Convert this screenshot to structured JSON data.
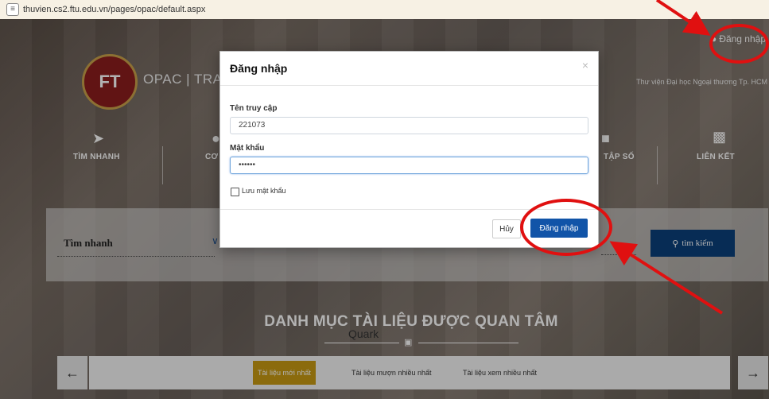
{
  "browser": {
    "url": "thuvien.cs2.ftu.edu.vn/pages/opac/default.aspx"
  },
  "header": {
    "login_link": "Đăng nhập",
    "opac_label": "OPAC | TRA",
    "library_name": "Thư viện Đại học Ngoại thương Tp. HCM",
    "logo_text": "FT"
  },
  "nav": [
    {
      "label": "TÌM NHANH",
      "icon": "rocket-icon"
    },
    {
      "label": "CƠ",
      "icon": "compass-icon"
    },
    {
      "label": "TẬP SỐ",
      "icon": "collection-icon"
    },
    {
      "label": "LIÊN KẾT",
      "icon": "sitemap-icon"
    }
  ],
  "search": {
    "mode_label": "Tìm nhanh",
    "button_label": "tìm kiếm"
  },
  "catalog": {
    "title": "DANH MỤC TÀI LIỆU ĐƯỢC QUAN TÂM",
    "background_text": "Quark",
    "tabs": [
      "Tài liệu mới nhất",
      "Tài liệu mượn nhiều nhất",
      "Tài liệu xem nhiều nhất"
    ],
    "prev_arrow": "←",
    "next_arrow": "→"
  },
  "modal": {
    "title": "Đăng nhập",
    "close": "×",
    "username_label": "Tên truy cập",
    "username_value": "221073",
    "password_label": "Mật khẩu",
    "password_value": "••••••",
    "remember_label": "Lưu mật khẩu",
    "cancel_label": "Hủy",
    "submit_label": "Đăng nhập"
  },
  "annotation_color": "#e01010"
}
